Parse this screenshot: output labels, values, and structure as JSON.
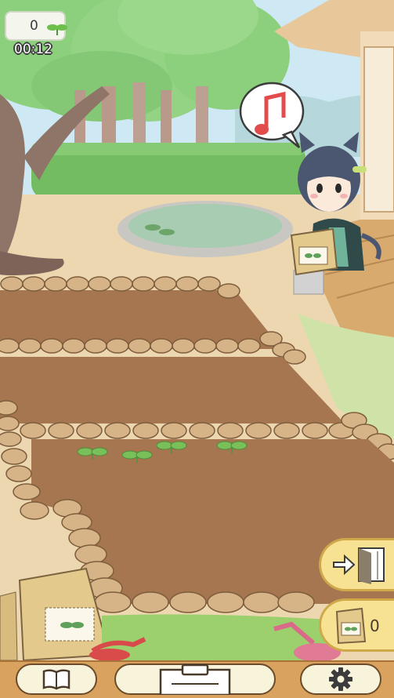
{
  "hud": {
    "sprout_count": "0",
    "timer": "00:12",
    "sprout_icon": "sprout-icon"
  },
  "speech_bubble": {
    "icon": "music-note-icon"
  },
  "seed_button": {
    "count": "0",
    "icon": "seed-bag-icon"
  },
  "exit_button": {
    "icon": "exit-door-icon"
  },
  "bottom_bar": {
    "left_icon": "book-icon",
    "center_icon": "clipboard-icon",
    "right_icon": "gear-icon"
  },
  "sprouts": [
    {
      "col": 1
    },
    {
      "col": 2
    },
    {
      "col": 3
    },
    {
      "col": 5
    }
  ],
  "colors": {
    "soil": "#a57650",
    "path": "#e9d4ad",
    "grass": "#8cc87a",
    "button_fill": "#f7e293",
    "button_border": "#cfa84a",
    "wood_bar": "#d9a25f"
  }
}
